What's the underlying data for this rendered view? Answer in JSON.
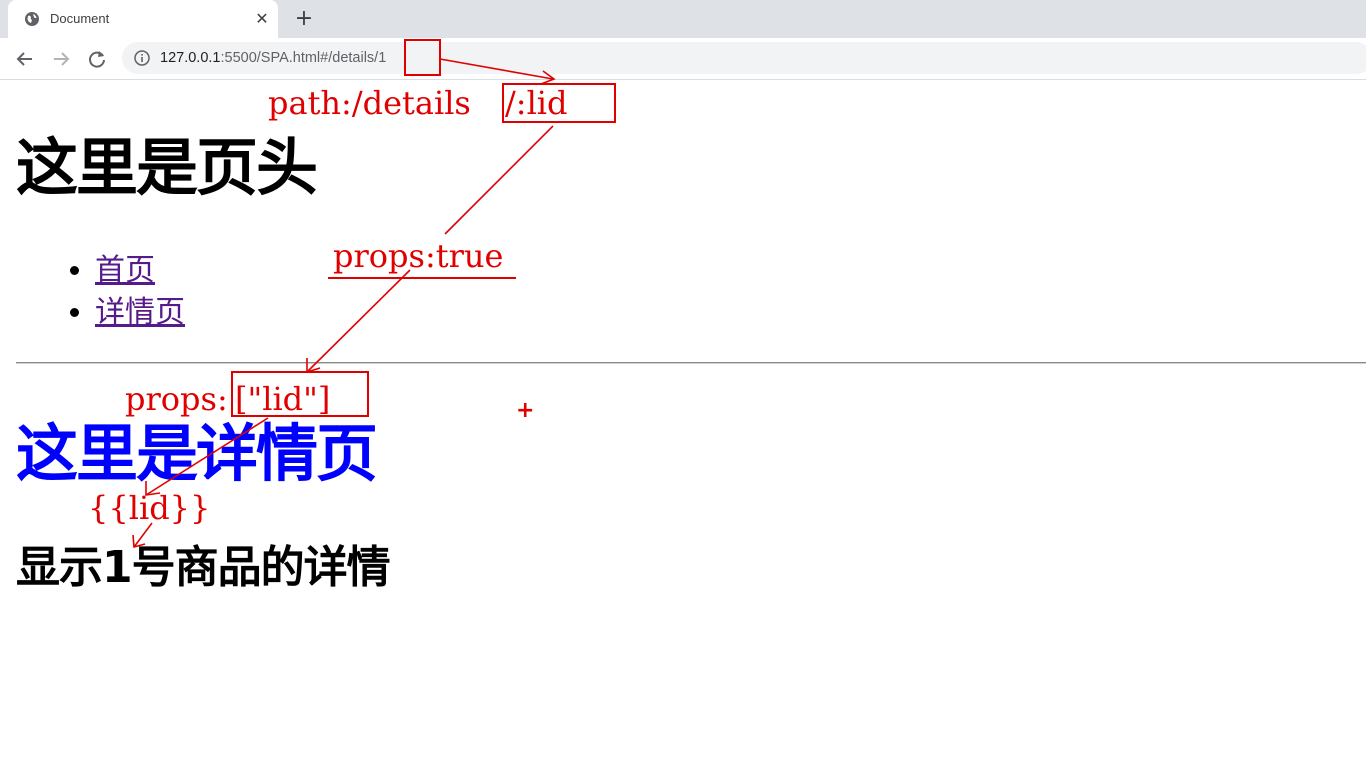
{
  "browser": {
    "tab_title": "Document",
    "tab_close": "✕",
    "new_tab": "+",
    "url_host": "127.0.0.1",
    "url_rest": ":5500/SPA.html#/details/1",
    "icons": {
      "favicon": "globe-icon",
      "close": "close-icon",
      "new_tab": "plus-icon",
      "back": "back-arrow-icon",
      "forward": "forward-arrow-icon",
      "reload": "reload-icon",
      "site_info": "info-icon"
    }
  },
  "page": {
    "header": "这里是页头",
    "nav": [
      "首页",
      "详情页"
    ],
    "details_title": "这里是详情页",
    "details_text": "显示1号商品的详情"
  },
  "annotations": {
    "path_prefix": "path:/details",
    "path_param": "/:lid",
    "props_true": "props:true",
    "props_label": "props:",
    "props_array": "[\"lid\"]",
    "interpolation": "{{lid}}",
    "cursor": "+"
  },
  "colors": {
    "annotation": "#e00000",
    "details_title": "#0000ff",
    "visited_link": "#551a8b",
    "tabstrip": "#dee1e6",
    "omnibox": "#f1f3f4"
  }
}
